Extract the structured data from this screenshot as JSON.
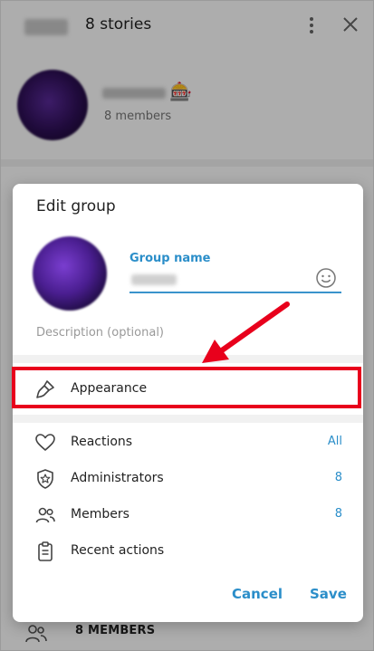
{
  "background": {
    "title": "8 stories",
    "members_text": "8 members",
    "bottom_members": "8 MEMBERS"
  },
  "dialog": {
    "title": "Edit group",
    "group_name_label": "Group name",
    "group_name_value": "",
    "description_placeholder": "Description (optional)",
    "items": [
      {
        "label": "Appearance",
        "value": "",
        "icon": "brush-icon"
      },
      {
        "label": "Reactions",
        "value": "All",
        "icon": "heart-icon"
      },
      {
        "label": "Administrators",
        "value": "8",
        "icon": "shield-star-icon"
      },
      {
        "label": "Members",
        "value": "8",
        "icon": "people-icon"
      },
      {
        "label": "Recent actions",
        "value": "",
        "icon": "clipboard-icon"
      }
    ],
    "cancel_label": "Cancel",
    "save_label": "Save"
  },
  "colors": {
    "accent": "#2b8ec9",
    "annotation": "#e8001c"
  }
}
